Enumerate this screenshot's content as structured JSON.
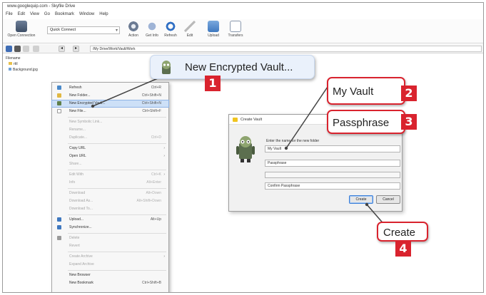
{
  "window": {
    "title": "www.googlequip.com - Skyfile Drive"
  },
  "menubar": [
    "File",
    "Edit",
    "View",
    "Go",
    "Bookmark",
    "Window",
    "Help"
  ],
  "toolbar": {
    "open_connection": "Open Connection",
    "quick_connect": "Quick Connect",
    "buttons": [
      "Action",
      "Get Info",
      "Refresh",
      "Edit",
      "Upload",
      "Transfers"
    ]
  },
  "nav": {
    "path": "/My Drive/Work/Vault/Work"
  },
  "tree": {
    "header": "Filename",
    "items": [
      "rttl",
      "Background.jpg"
    ]
  },
  "context_menu": {
    "items": [
      {
        "label": "Refresh",
        "shortcut": "Ctrl+R",
        "disabled": false,
        "highlight": false
      },
      {
        "label": "New Folder...",
        "shortcut": "Ctrl+Shift+N",
        "disabled": false,
        "highlight": false
      },
      {
        "label": "New Encrypted Vault...",
        "shortcut": "Ctrl+Shift+N",
        "disabled": false,
        "highlight": true
      },
      {
        "label": "New File...",
        "shortcut": "Ctrl+Shift+F",
        "disabled": false,
        "highlight": false
      },
      {
        "label": "New Symbolic Link...",
        "shortcut": "",
        "disabled": true,
        "highlight": false
      },
      {
        "label": "Rename...",
        "shortcut": "",
        "disabled": true,
        "highlight": false
      },
      {
        "label": "Duplicate...",
        "shortcut": "Ctrl+D",
        "disabled": true,
        "highlight": false
      },
      {
        "label": "Copy URL",
        "shortcut": "",
        "disabled": false,
        "highlight": false,
        "sub": true
      },
      {
        "label": "Open URL",
        "shortcut": "",
        "disabled": false,
        "highlight": false,
        "sub": true
      },
      {
        "label": "Share...",
        "shortcut": "",
        "disabled": true,
        "highlight": false
      },
      {
        "label": "Edit With",
        "shortcut": "Ctrl+K",
        "disabled": true,
        "highlight": false,
        "sub": true
      },
      {
        "label": "Info",
        "shortcut": "Alt+Enter",
        "disabled": true,
        "highlight": false
      },
      {
        "label": "Download",
        "shortcut": "Alt+Down",
        "disabled": true,
        "highlight": false
      },
      {
        "label": "Download As...",
        "shortcut": "Alt+Shift+Down",
        "disabled": true,
        "highlight": false
      },
      {
        "label": "Download To...",
        "shortcut": "",
        "disabled": true,
        "highlight": false
      },
      {
        "label": "Upload...",
        "shortcut": "Alt+Up",
        "disabled": false,
        "highlight": false
      },
      {
        "label": "Synchronize...",
        "shortcut": "",
        "disabled": false,
        "highlight": false
      },
      {
        "label": "Delete",
        "shortcut": "",
        "disabled": true,
        "highlight": false
      },
      {
        "label": "Revert",
        "shortcut": "",
        "disabled": true,
        "highlight": false
      },
      {
        "label": "Create Archive",
        "shortcut": "",
        "disabled": true,
        "highlight": false,
        "sub": true
      },
      {
        "label": "Expand Archive",
        "shortcut": "",
        "disabled": true,
        "highlight": false
      },
      {
        "label": "New Browser",
        "shortcut": "",
        "disabled": false,
        "highlight": false
      },
      {
        "label": "New Bookmark",
        "shortcut": "Ctrl+Shift+B",
        "disabled": false,
        "highlight": false
      }
    ]
  },
  "dialog": {
    "title": "Create Vault",
    "prompt": "Enter the name for the new folder",
    "name_value": "My Vault",
    "passphrase_value": "Passphrase",
    "confirm_placeholder": "Confirm Passphrase",
    "create_label": "Create",
    "cancel_label": "Cancel"
  },
  "callouts": {
    "new_vault": "New Encrypted Vault...",
    "name": "My Vault",
    "passphrase": "Passphrase",
    "create": "Create",
    "badges": [
      "1",
      "2",
      "3",
      "4"
    ]
  },
  "colors": {
    "callout_red": "#d9232e",
    "highlight_blue": "#cde0f7"
  }
}
